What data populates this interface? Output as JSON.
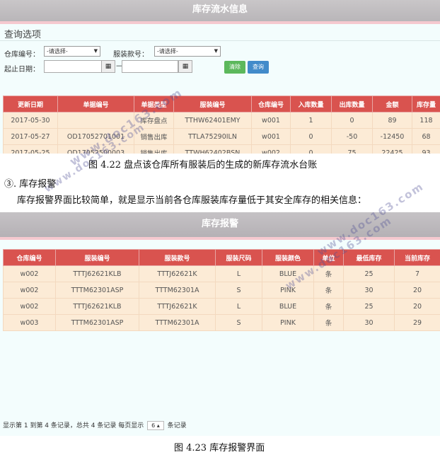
{
  "flow_panel": {
    "title": "库存流水信息",
    "query_title": "查询选项",
    "warehouse_label": "仓库编号：",
    "warehouse_value": "-请选择-",
    "style_label": "服装款号：",
    "style_value": "-请选择-",
    "date_label": "起止日期：",
    "date_sep": "—",
    "clear_label": "清除",
    "query_label": "查询",
    "headers": [
      "更新日期",
      "单据编号",
      "单据类型",
      "服装编号",
      "仓库编号",
      "入库数量",
      "出库数量",
      "金额",
      "库存量"
    ],
    "rows": [
      [
        "2017-05-30",
        "",
        "库存盘点",
        "TTHW62401EMY",
        "w001",
        "1",
        "0",
        "89",
        "118"
      ],
      [
        "2017-05-27",
        "OD17052701001",
        "销售出库",
        "TTLA75290ILN",
        "w001",
        "0",
        "-50",
        "-12450",
        "68"
      ],
      [
        "2017-05-25",
        "OD17052500003",
        "销售出库",
        "TTWH62402BSN",
        "w002",
        "0",
        "75",
        "22425",
        "93"
      ]
    ]
  },
  "caption1": "图 4.22  盘点该仓库所有服装后的生成的新库存流水台账",
  "section_heading": "③. 库存报警",
  "section_text": "库存报警界面比较简单，就是显示当前各仓库服装库存量低于其安全库存的相关信息：",
  "alarm_panel": {
    "title": "库存报警",
    "headers": [
      "仓库编号",
      "服装编号",
      "服装款号",
      "服装尺码",
      "服装颜色",
      "单位",
      "最低库存",
      "当前库存"
    ],
    "rows": [
      [
        "w002",
        "TTTJ62621KLB",
        "TTTJ62621K",
        "L",
        "BLUE",
        "条",
        "25",
        "7"
      ],
      [
        "w002",
        "TTTM62301ASP",
        "TTTM62301A",
        "S",
        "PINK",
        "条",
        "30",
        "20"
      ],
      [
        "w002",
        "TTTJ62621KLB",
        "TTTJ62621K",
        "L",
        "BLUE",
        "条",
        "25",
        "20"
      ],
      [
        "w003",
        "TTTM62301ASP",
        "TTTM62301A",
        "S",
        "PINK",
        "条",
        "30",
        "29"
      ]
    ],
    "pager_prefix": "显示第 1 到第 4 条记录，总共 4 条记录 每页显示",
    "page_size": "6",
    "pager_suffix": "条记录"
  },
  "caption2": "图 4.23  库存报警界面",
  "watermark": "www.doc163.com",
  "colors": {
    "header_red": "#d9534f",
    "row_beige": "#fcebd6",
    "panel_bg": "#f3fdfd"
  }
}
